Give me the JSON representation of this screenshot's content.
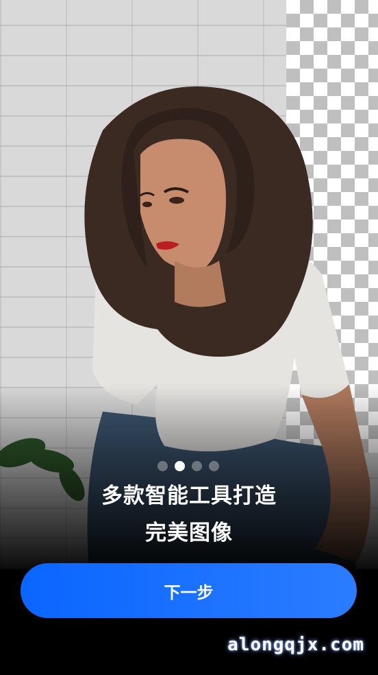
{
  "onboarding": {
    "headline_line1": "多款智能工具打造",
    "headline_line2": "完美图像",
    "next_label": "下一步",
    "watermark": "alongqjx.com",
    "pages_total": 4,
    "current_page": 2
  },
  "colors": {
    "button_start": "#0a66ff",
    "button_end": "#2b7cff",
    "background": "#000000",
    "dot_active": "#ffffff",
    "dot_inactive": "#9a9a9a"
  }
}
